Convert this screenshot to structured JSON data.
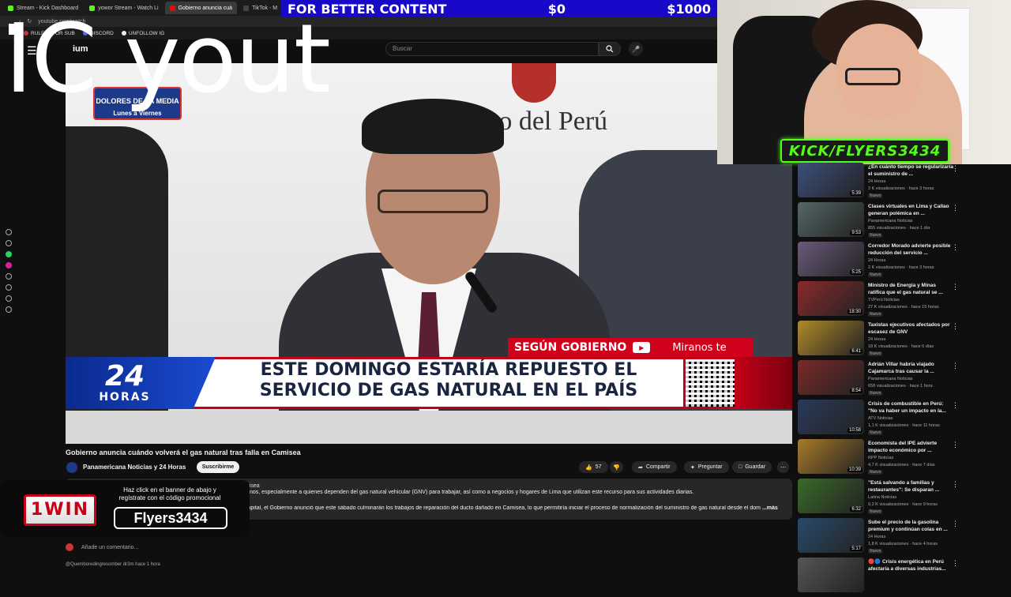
{
  "browser": {
    "tabs": [
      {
        "label": "Stream - Kick Dashboard",
        "active": false
      },
      {
        "label": "yowor Stream - Watch Li",
        "active": false
      },
      {
        "label": "Gobierno anuncia cuá",
        "active": true
      },
      {
        "label": "TikTok - M",
        "active": false
      }
    ],
    "url": "youtube.com/watch",
    "bookmarks": [
      "RULETA POR SUB",
      "DISCORD",
      "UNFOLLOW IG"
    ]
  },
  "overlay": {
    "donation_label": "FOR BETTER CONTENT",
    "donation_current": "$0",
    "donation_goal": "$1000",
    "big_text": "IC yout",
    "kick_tag": "KICK/FLYERS3434"
  },
  "youtube": {
    "logo_text": "ium",
    "search_placeholder": "Buscar",
    "video": {
      "show_badge_top": "DOLORES DE LA MEDIA",
      "show_badge_bottom": "Lunes a Viernes",
      "gov_text": "rno del Perú",
      "segun_label": "SEGÚN GOBIERNO",
      "miranos": "Miranos te",
      "brand_num": "24",
      "brand_word": "HORAS",
      "headline": "ESTE DOMINGO ESTARÍA REPUESTO EL SERVICIO DE GAS NATURAL EN EL PAÍS"
    },
    "title": "Gobierno anuncia cuándo volverá el gas natural tras falla en Camisea",
    "channel": "Panamericana Noticias y 24 Horas",
    "subscribe": "Suscribirme",
    "likes": "57",
    "share": "Compartir",
    "ask": "Preguntar",
    "save": "Guardar",
    "desc_line1": "misea",
    "desc_line2": "nos, especialmente a quienes dependen del gas natural vehicular (GNV) para trabajar, así como a negocios y hogares de Lima que utilizan este recurso para sus actividades diarias.",
    "desc_line3": "capital, el Gobierno anunció que este sábado culminarán los trabajos de reparación del ducto dañado en Camisea, lo que permitiría iniciar el proceso de normalización del suministro de gas natural desde el dom",
    "desc_more": "...más",
    "add_comment": "Añade un comentario...",
    "comment2": "@Quemboredingresomber dr3m hace 1 hora"
  },
  "promo": {
    "brand": "1WIN",
    "text": "Haz click en el banner de abajo y regístrate con el código promocional",
    "code": "Flyers3434"
  },
  "sidebar": [
    {
      "title": "¿En cuánto tiempo se regularizaría el suministro de ...",
      "channel": "24 Horas",
      "meta": "2 K visualizaciones · hace 3 horas",
      "badge": "Nuevo",
      "duration": "5:39",
      "color": "#3d4f7a"
    },
    {
      "title": "Clases virtuales en Lima y Callao generan polémica en ...",
      "channel": "Panamericana Noticias",
      "meta": "855 visualizaciones · hace 1 día",
      "badge": "Nuevo",
      "duration": "9:53",
      "color": "#566"
    },
    {
      "title": "Corredor Morado advierte posible reducción del servicio ...",
      "channel": "24 Horas",
      "meta": "2 K visualizaciones · hace 3 horas",
      "badge": "Nuevo",
      "duration": "5:25",
      "color": "#6a5a7a"
    },
    {
      "title": "Ministro de Energía y Minas ratifica que el gas natural se ...",
      "channel": "TVPerú Noticias",
      "meta": "27 K visualizaciones · hace 15 horas",
      "badge": "Nuevo",
      "duration": "18:30",
      "color": "#8a2a2a"
    },
    {
      "title": "Taxistas ejecutivos afectados por escasez de GNV",
      "channel": "24 Horas",
      "meta": "18 K visualizaciones · hace 6 días",
      "badge": "Nuevo",
      "duration": "6:41",
      "color": "#b08a2a"
    },
    {
      "title": "Adrián Villar habría viajado Cajamarca tras causar la ...",
      "channel": "Panamericana Noticias",
      "meta": "658 visualizaciones · hace 1 hora",
      "badge": "Nuevo",
      "duration": "8:54",
      "color": "#7a2a2a"
    },
    {
      "title": "Crisis de combustible en Perú: \"No va haber un impacto en la...",
      "channel": "ATV Noticias",
      "meta": "1,1 K visualizaciones · hace 11 horas",
      "badge": "Nuevo",
      "duration": "10:58",
      "color": "#2a3a5a"
    },
    {
      "title": "Economista del IPE advierte impacto económico por ...",
      "channel": "RPP Noticias",
      "meta": "4,7 K visualizaciones · hace 7 días",
      "badge": "Nuevo",
      "duration": "10:39",
      "color": "#a87a2a"
    },
    {
      "title": "\"Está salvando a familias y restaurantes\": Se disparan ...",
      "channel": "Latina Noticias",
      "meta": "9,2 K visualizaciones · hace 9 horas",
      "badge": "Nuevo",
      "duration": "6:32",
      "color": "#3a6a2a"
    },
    {
      "title": "Sube el precio de la gasolina premium y continúan colas en ...",
      "channel": "24 Horas",
      "meta": "1,8 K visualizaciones · hace 4 horas",
      "badge": "Nuevo",
      "duration": "5:17",
      "color": "#2a4a6a"
    },
    {
      "title": "🔴🔵 Crisis energética en Perú afectaría a diversas industrias...",
      "channel": "",
      "meta": "",
      "badge": "",
      "duration": "",
      "color": "#555"
    }
  ]
}
